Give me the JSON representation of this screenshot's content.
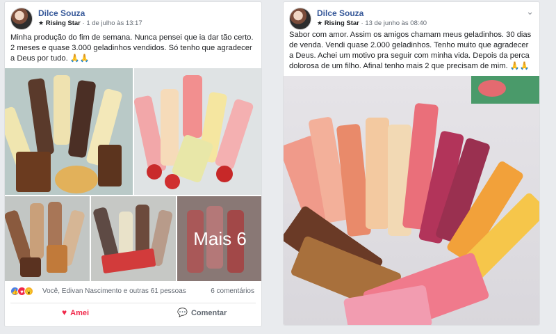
{
  "posts": [
    {
      "author": "Dilce Souza",
      "badge": "Rising Star",
      "date": "1 de julho às 13:17",
      "text": "Minha produção do fim de semana. Nunca pensei que ia dar tão certo. 2 meses e quase 3.000 geladinhos vendidos. Só tenho que agradecer a Deus por tudo. 🙏🙏",
      "more_overlay": "Mais 6",
      "reactions_text": "Você, Edivan Nascimento e outras 61 pessoas",
      "comments_count": "6 comentários",
      "actions": {
        "love": "Amei",
        "comment": "Comentar"
      }
    },
    {
      "author": "Dilce Souza",
      "badge": "Rising Star",
      "date": "13 de junho às 08:40",
      "text": "Sabor com amor. Assim os amigos chamam meus geladinhos. 30 dias de venda. Vendi quase 2.000 geladinhos. Tenho muito que agradecer a Deus. Achei um motivo pra seguir com minha vida. Depois da perca dolorosa de um filho. Afinal tenho mais 2 que precisam de mim. 🙏🙏"
    }
  ],
  "icons": {
    "options": "ellipsis-icon",
    "badge": "star-icon",
    "like": "like-reaction-icon",
    "love": "love-reaction-icon",
    "wow": "wow-reaction-icon",
    "comment": "comment-icon"
  },
  "colors": {
    "author": "#365899",
    "love": "#f0284a",
    "like": "#4a7fe8"
  }
}
